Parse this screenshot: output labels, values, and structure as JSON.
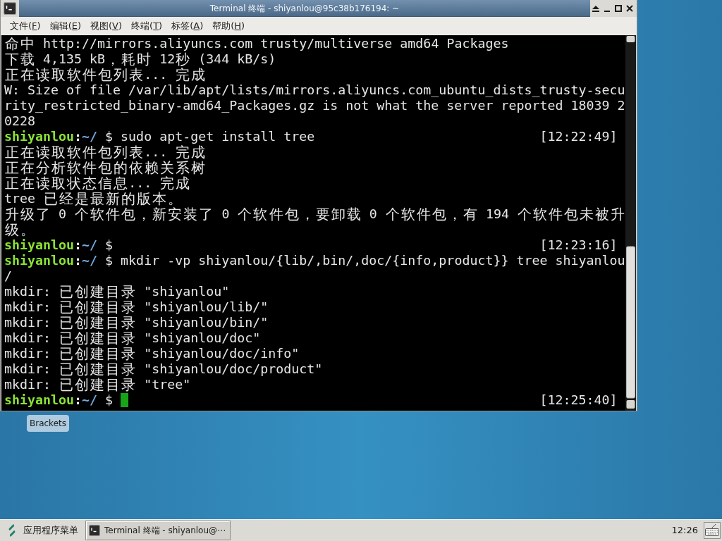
{
  "window": {
    "title": "Terminal 终端 - shiyanlou@95c38b176194: ~"
  },
  "menu": [
    {
      "text": "文件(",
      "mnemonic": "F",
      "tail": ")"
    },
    {
      "text": "编辑(",
      "mnemonic": "E",
      "tail": ")"
    },
    {
      "text": "视图(",
      "mnemonic": "V",
      "tail": ")"
    },
    {
      "text": "终端(",
      "mnemonic": "T",
      "tail": ")"
    },
    {
      "text": "标签(",
      "mnemonic": "A",
      "tail": ")"
    },
    {
      "text": "帮助(",
      "mnemonic": "H",
      "tail": ")"
    }
  ],
  "terminal": {
    "rows": [
      {
        "kind": "output",
        "text": "命中 http://mirrors.aliyuncs.com trusty/multiverse amd64 Packages"
      },
      {
        "kind": "output",
        "text": "下载 4,135 kB，耗时 12秒 (344 kB/s)"
      },
      {
        "kind": "output",
        "text": "正在读取软件包列表... 完成"
      },
      {
        "kind": "output",
        "text": "W: Size of file /var/lib/apt/lists/mirrors.aliyuncs.com_ubuntu_dists_trusty-secu"
      },
      {
        "kind": "output",
        "text": "rity_restricted_binary-amd64_Packages.gz is not what the server reported 18039 2"
      },
      {
        "kind": "output",
        "text": "0228"
      },
      {
        "kind": "prompt",
        "user": "shiyanlou",
        "separator": ":",
        "path": "~/",
        "symbol": "$",
        "command": "sudo apt-get install tree",
        "time": "[12:22:49]",
        "cursor": false
      },
      {
        "kind": "output",
        "text": "正在读取软件包列表... 完成"
      },
      {
        "kind": "output",
        "text": "正在分析软件包的依赖关系树"
      },
      {
        "kind": "output",
        "text": "正在读取状态信息... 完成"
      },
      {
        "kind": "output",
        "text": "tree 已经是最新的版本。"
      },
      {
        "kind": "output",
        "text": "升级了 0 个软件包，新安装了 0 个软件包，要卸载 0 个软件包，有 194 个软件包未被升"
      },
      {
        "kind": "output",
        "text": "级。"
      },
      {
        "kind": "prompt",
        "user": "shiyanlou",
        "separator": ":",
        "path": "~/",
        "symbol": "$",
        "time": "[12:23:16]",
        "cursor": false
      },
      {
        "kind": "prompt",
        "user": "shiyanlou",
        "separator": ":",
        "path": "~/",
        "symbol": "$",
        "command": "mkdir -vp shiyanlou/{lib/,bin/,doc/{info,product}} tree shiyanlou",
        "cursor": false
      },
      {
        "kind": "output",
        "text": "/"
      },
      {
        "kind": "output",
        "text": "mkdir: 已创建目录 \"shiyanlou\""
      },
      {
        "kind": "output",
        "text": "mkdir: 已创建目录 \"shiyanlou/lib/\""
      },
      {
        "kind": "output",
        "text": "mkdir: 已创建目录 \"shiyanlou/bin/\""
      },
      {
        "kind": "output",
        "text": "mkdir: 已创建目录 \"shiyanlou/doc\""
      },
      {
        "kind": "output",
        "text": "mkdir: 已创建目录 \"shiyanlou/doc/info\""
      },
      {
        "kind": "output",
        "text": "mkdir: 已创建目录 \"shiyanlou/doc/product\""
      },
      {
        "kind": "output",
        "text": "mkdir: 已创建目录 \"tree\""
      },
      {
        "kind": "prompt",
        "user": "shiyanlou",
        "separator": ":",
        "path": "~/",
        "symbol": "$",
        "time": "[12:25:40]",
        "cursor": true
      }
    ]
  },
  "desktop_icons": [
    {
      "label": "Brackets"
    }
  ],
  "taskbar": {
    "app_menu": "应用程序菜单",
    "tasks": [
      {
        "label": "Terminal 终端 - shiyanlou@⋯",
        "selected": true
      }
    ],
    "clock": "12:26"
  }
}
